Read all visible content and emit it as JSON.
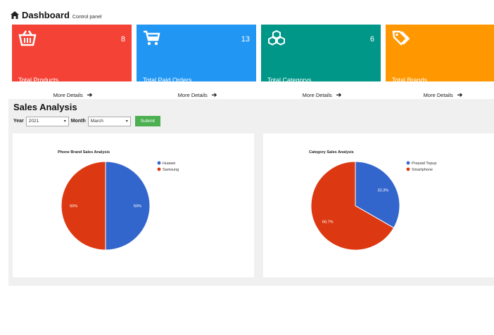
{
  "header": {
    "title": "Dashboard",
    "subtitle": "Control panel"
  },
  "cards": [
    {
      "count": "8",
      "label": "Total Products",
      "button": "More Details",
      "color": "#f44336",
      "icon": "basket-icon"
    },
    {
      "count": "13",
      "label": "Total Paid Orders",
      "button": "More Details",
      "color": "#2196f3",
      "icon": "cart-icon"
    },
    {
      "count": "6",
      "label": "Total Categorys",
      "button": "More Details",
      "color": "#009688",
      "icon": "cubes-icon"
    },
    {
      "count": "",
      "label": "Total Brands",
      "button": "More Details",
      "color": "#ff9800",
      "icon": "tags-icon"
    }
  ],
  "sales": {
    "title": "Sales Analysis",
    "year_label": "Year",
    "year_value": "2021",
    "month_label": "Month",
    "month_value": "March",
    "submit": "Submit"
  },
  "chart_data": [
    {
      "type": "pie",
      "title": "Phone Brand Sales Analysis",
      "categories": [
        "Huawei",
        "Samsung"
      ],
      "values": [
        50,
        50
      ],
      "labels": [
        "50%",
        "50%"
      ],
      "colors": [
        "#3366cc",
        "#dc3912"
      ],
      "legend": "right"
    },
    {
      "type": "pie",
      "title": "Category Sales Analysis",
      "categories": [
        "Prepaid Topup",
        "Smartphone"
      ],
      "values": [
        33.3,
        66.7
      ],
      "labels": [
        "33.3%",
        "66.7%"
      ],
      "colors": [
        "#3366cc",
        "#dc3912"
      ],
      "legend": "right"
    }
  ]
}
